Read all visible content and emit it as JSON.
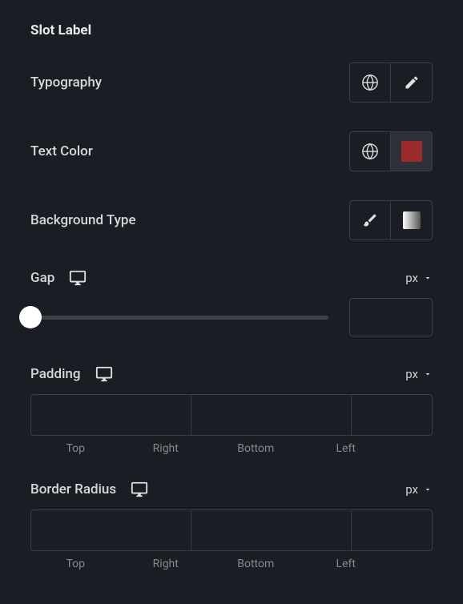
{
  "section": {
    "title": "Slot Label"
  },
  "typography": {
    "label": "Typography"
  },
  "textColor": {
    "label": "Text Color",
    "color": "#9c2b2b"
  },
  "backgroundType": {
    "label": "Background Type"
  },
  "gap": {
    "label": "Gap",
    "unit": "px",
    "value": ""
  },
  "padding": {
    "label": "Padding",
    "unit": "px",
    "sides": {
      "top": "Top",
      "right": "Right",
      "bottom": "Bottom",
      "left": "Left"
    },
    "values": {
      "top": "",
      "right": "",
      "bottom": "",
      "left": ""
    }
  },
  "borderRadius": {
    "label": "Border Radius",
    "unit": "px",
    "sides": {
      "top": "Top",
      "right": "Right",
      "bottom": "Bottom",
      "left": "Left"
    },
    "values": {
      "top": "",
      "right": "",
      "bottom": "",
      "left": ""
    }
  }
}
